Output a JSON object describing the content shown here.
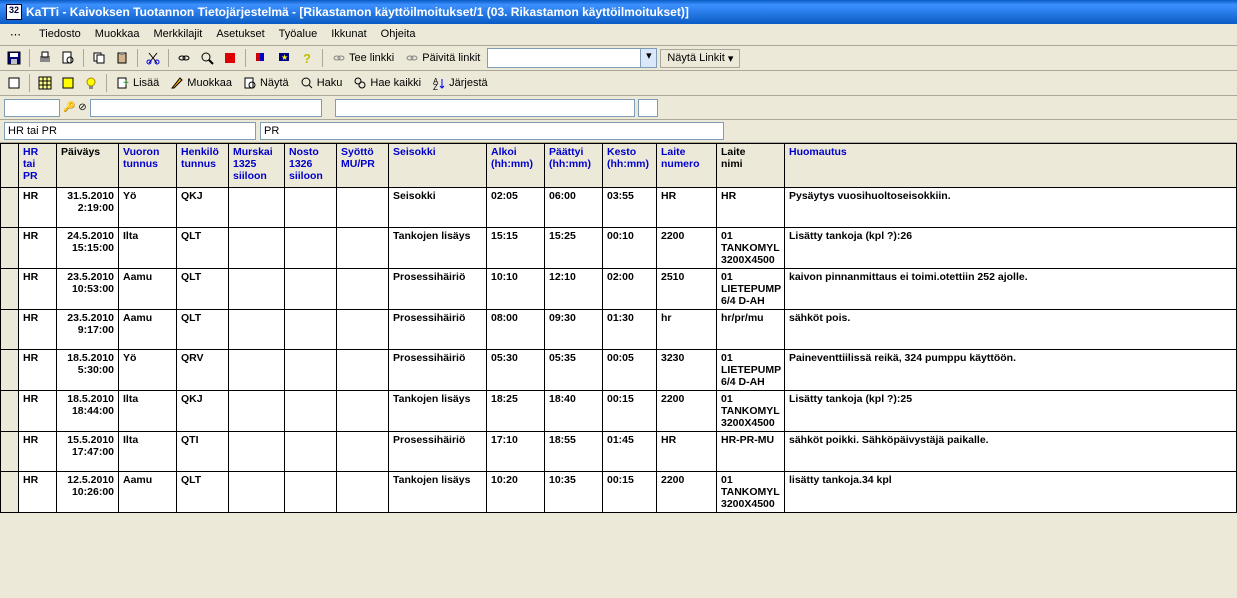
{
  "title": "KaTTi - Kaivoksen Tuotannon Tietojärjestelmä - [Rikastamon käyttöilmoitukset/1 (03. Rikastamon käyttöilmoitukset)]",
  "menu": [
    "Tiedosto",
    "Muokkaa",
    "Merkkilajit",
    "Asetukset",
    "Työalue",
    "Ikkunat",
    "Ohjeita"
  ],
  "toolbar1": {
    "teelinkki": "Tee linkki",
    "paivitalinkit": "Päivitä linkit",
    "naytalinkit": "Näytä Linkit"
  },
  "toolbar2": {
    "lisaa": "Lisää",
    "muokkaa": "Muokkaa",
    "nayta": "Näytä",
    "haku": "Haku",
    "haekaikki": "Hae kaikki",
    "jarjesta": "Järjestä"
  },
  "filter1_value": "",
  "filter2_label": "HR tai PR",
  "filter3_label": "PR",
  "headers": {
    "hrpr": "HR\ntai\nPR",
    "paivays": "Päiväys",
    "vuoron": "Vuoron\ntunnus",
    "henkilo": "Henkilö\ntunnus",
    "murska": "Murskai\n1325\nsiiloon",
    "nosto": "Nosto\n1326\nsiiloon",
    "syotto": "Syöttö\nMU/PR",
    "seisokki": "Seisokki",
    "alkoi": "Alkoi\n(hh:mm)",
    "paattyi": "Päättyi\n(hh:mm)",
    "kesto": "Kesto\n(hh:mm)",
    "laitenum": "Laite\nnumero",
    "laitenimi": "Laite\nnimi",
    "huomautus": "Huomautus"
  },
  "rows": [
    {
      "hrpr": "HR",
      "date": "31.5.2010",
      "time": "2:19:00",
      "vuoro": "Yö",
      "henkilo": "QKJ",
      "murska": "",
      "nosto": "",
      "syotto": "",
      "seisokki": "Seisokki",
      "alkoi": "02:05",
      "paattyi": "06:00",
      "kesto": "03:55",
      "laitenum": "HR",
      "laitenimi": "HR",
      "huom": "Pysäytys vuosihuoltoseisokkiin."
    },
    {
      "hrpr": "HR",
      "date": "24.5.2010",
      "time": "15:15:00",
      "vuoro": "Ilta",
      "henkilo": "QLT",
      "murska": "",
      "nosto": "",
      "syotto": "",
      "seisokki": "Tankojen lisäys",
      "alkoi": "15:15",
      "paattyi": "15:25",
      "kesto": "00:10",
      "laitenum": "2200",
      "laitenimi": "01 TANKOMYL 3200X4500",
      "huom": "Lisätty tankoja (kpl ?):26"
    },
    {
      "hrpr": "HR",
      "date": "23.5.2010",
      "time": "10:53:00",
      "vuoro": "Aamu",
      "henkilo": "QLT",
      "murska": "",
      "nosto": "",
      "syotto": "",
      "seisokki": "Prosessihäiriö",
      "alkoi": "10:10",
      "paattyi": "12:10",
      "kesto": "02:00",
      "laitenum": "2510",
      "laitenimi": "01 LIETEPUMP 6/4 D-AH",
      "huom": "kaivon pinnanmittaus ei toimi.otettiin 252 ajolle."
    },
    {
      "hrpr": "HR",
      "date": "23.5.2010",
      "time": "9:17:00",
      "vuoro": "Aamu",
      "henkilo": "QLT",
      "murska": "",
      "nosto": "",
      "syotto": "",
      "seisokki": "Prosessihäiriö",
      "alkoi": "08:00",
      "paattyi": "09:30",
      "kesto": "01:30",
      "laitenum": "hr",
      "laitenimi": "hr/pr/mu",
      "huom": "sähköt pois."
    },
    {
      "hrpr": "HR",
      "date": "18.5.2010",
      "time": "5:30:00",
      "vuoro": "Yö",
      "henkilo": "QRV",
      "murska": "",
      "nosto": "",
      "syotto": "",
      "seisokki": "Prosessihäiriö",
      "alkoi": "05:30",
      "paattyi": "05:35",
      "kesto": "00:05",
      "laitenum": "3230",
      "laitenimi": "01 LIETEPUMP 6/4 D-AH",
      "huom": "Paineventtiilissä reikä, 324 pumppu käyttöön."
    },
    {
      "hrpr": "HR",
      "date": "18.5.2010",
      "time": "18:44:00",
      "vuoro": "Ilta",
      "henkilo": "QKJ",
      "murska": "",
      "nosto": "",
      "syotto": "",
      "seisokki": "Tankojen lisäys",
      "alkoi": "18:25",
      "paattyi": "18:40",
      "kesto": "00:15",
      "laitenum": "2200",
      "laitenimi": "01 TANKOMYL 3200X4500",
      "huom": "Lisätty tankoja (kpl ?):25"
    },
    {
      "hrpr": "HR",
      "date": "15.5.2010",
      "time": "17:47:00",
      "vuoro": "Ilta",
      "henkilo": "QTI",
      "murska": "",
      "nosto": "",
      "syotto": "",
      "seisokki": "Prosessihäiriö",
      "alkoi": "17:10",
      "paattyi": "18:55",
      "kesto": "01:45",
      "laitenum": "HR",
      "laitenimi": "HR-PR-MU",
      "huom": "sähköt poikki. Sähköpäivystäjä paikalle."
    },
    {
      "hrpr": "HR",
      "date": "12.5.2010",
      "time": "10:26:00",
      "vuoro": "Aamu",
      "henkilo": "QLT",
      "murska": "",
      "nosto": "",
      "syotto": "",
      "seisokki": "Tankojen lisäys",
      "alkoi": "10:20",
      "paattyi": "10:35",
      "kesto": "00:15",
      "laitenum": "2200",
      "laitenimi": "01 TANKOMYL 3200X4500",
      "huom": "lisätty tankoja.34 kpl"
    }
  ]
}
